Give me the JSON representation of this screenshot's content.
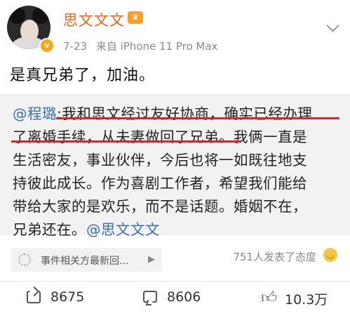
{
  "post": {
    "username": "思文文文",
    "member_badge": "♛",
    "verified_badge": "v",
    "date": "7-23",
    "source": "来自 iPhone 11 Pro Max",
    "text": "是真兄弟了，加油。"
  },
  "repost": {
    "mention_author": "@程璐",
    "line1_rest": ":我和思文经过友好协商，确实已经办理",
    "line2a": "了离婚手续，从夫妻做回了兄弟。",
    "line2b": "我俩一直是",
    "line3": "生活密友，事业伙伴，今后也将一如既往地支",
    "line4": "持彼此成长。作为喜剧工作者，希望我们能给",
    "line5": "带给大家的是欢乐，而不是话题。婚姻不在，",
    "line6_text": "兄弟还在。",
    "line6_mention": "@思文文文",
    "underline_color": "#d9262c"
  },
  "footer": {
    "related_label": "事件相关方最新回...",
    "attitude_text": "751人发表了态度",
    "repost_count": "8675",
    "comment_count": "8606",
    "like_count": "10.3万"
  },
  "colors": {
    "username": "#e8651a",
    "mention": "#3a6fb5",
    "repost_bg": "#f2f2f2"
  }
}
